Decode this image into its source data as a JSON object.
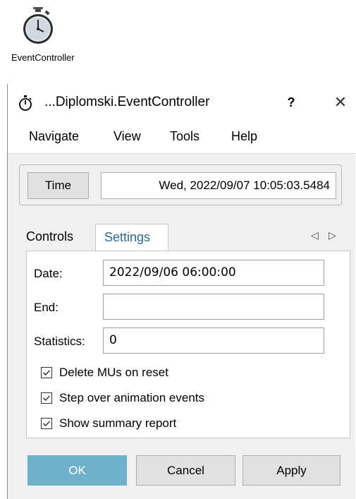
{
  "desktop": {
    "icon": "stopwatch-icon",
    "label": "EventController"
  },
  "dialog": {
    "title": "...Diplomski.EventController",
    "help_label": "?",
    "close_label": "✕",
    "menu": [
      "Navigate",
      "View",
      "Tools",
      "Help"
    ],
    "time_button_label": "Time",
    "time_value": "Wed, 2022/09/07 10:05:03.5484",
    "tabs": [
      {
        "label": "Controls",
        "active": false
      },
      {
        "label": "Settings",
        "active": true
      }
    ],
    "tab_nav": {
      "prev": "◁",
      "next": "▷"
    },
    "settings": {
      "fields": [
        {
          "label": "Date:",
          "value": "2022/09/06 06:00:00"
        },
        {
          "label": "End:",
          "value": ""
        },
        {
          "label": "Statistics:",
          "value": "0"
        }
      ],
      "checkboxes": [
        {
          "label": "Delete MUs on reset",
          "checked": true
        },
        {
          "label": "Step over animation events",
          "checked": true
        },
        {
          "label": "Show summary report",
          "checked": true
        }
      ]
    },
    "buttons": {
      "ok": "OK",
      "cancel": "Cancel",
      "apply": "Apply"
    },
    "colors": {
      "accent": "#6fb1cb",
      "tab_active_text": "#2a6aa8"
    }
  }
}
